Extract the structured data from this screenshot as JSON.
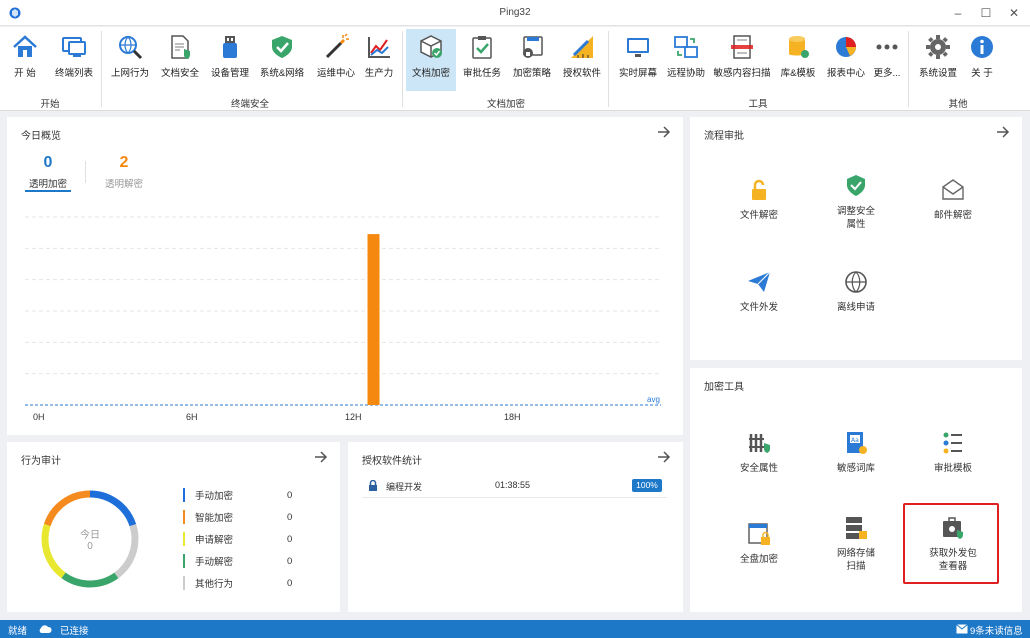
{
  "window": {
    "title": "Ping32"
  },
  "ribbon": {
    "items": [
      {
        "label": "开  始",
        "icon": "home-icon"
      },
      {
        "label": "终端列表",
        "icon": "monitor-list-icon"
      },
      {
        "label": "上网行为",
        "icon": "web-search-icon"
      },
      {
        "label": "文档安全",
        "icon": "document-shield-icon"
      },
      {
        "label": "设备管理",
        "icon": "usb-device-icon"
      },
      {
        "label": "系统&网络",
        "icon": "shield-firewall-icon"
      },
      {
        "label": "运维中心",
        "icon": "magic-wand-icon"
      },
      {
        "label": "生产力",
        "icon": "productivity-chart-icon"
      },
      {
        "label": "文档加密",
        "icon": "cube-encrypt-icon"
      },
      {
        "label": "审批任务",
        "icon": "clipboard-check-icon"
      },
      {
        "label": "加密策略",
        "icon": "lock-policy-icon"
      },
      {
        "label": "授权软件",
        "icon": "ruler-pencil-icon"
      },
      {
        "label": "实时屏幕",
        "icon": "screen-icon"
      },
      {
        "label": "远程协助",
        "icon": "remote-assist-icon"
      },
      {
        "label": "敏感内容扫描",
        "icon": "scan-document-icon"
      },
      {
        "label": "库&模板",
        "icon": "database-icon"
      },
      {
        "label": "报表中心",
        "icon": "pie-chart-icon"
      },
      {
        "label": "更多...",
        "icon": "more-dots-icon"
      },
      {
        "label": "系统设置",
        "icon": "gear-icon"
      },
      {
        "label": "关  于",
        "icon": "info-icon"
      }
    ],
    "groups": [
      "开始",
      "终端安全",
      "文档加密",
      "工具",
      "其他"
    ]
  },
  "overview": {
    "title": "今日概览",
    "stats": [
      {
        "value": "0",
        "label": "透明加密"
      },
      {
        "value": "2",
        "label": "透明解密"
      }
    ]
  },
  "chart_data": {
    "type": "bar",
    "x": [
      "0H",
      "6H",
      "12H",
      "18H"
    ],
    "avg_label": "avg",
    "bars": [
      {
        "hour": 13,
        "value": 2
      }
    ],
    "ylim": [
      0,
      2.2
    ],
    "grid": true,
    "color": "#f5890f"
  },
  "behavior": {
    "title": "行为审计",
    "donut_label": "今日",
    "donut_value": "0",
    "legend": [
      {
        "label": "手动加密",
        "value": "0",
        "color": "#1e6fd9"
      },
      {
        "label": "智能加密",
        "value": "0",
        "color": "#f58a1f"
      },
      {
        "label": "申请解密",
        "value": "0",
        "color": "#e8e830"
      },
      {
        "label": "手动解密",
        "value": "0",
        "color": "#3aa56a"
      },
      {
        "label": "其他行为",
        "value": "0",
        "color": "#cccccc"
      }
    ]
  },
  "software_stats": {
    "title": "授权软件统计",
    "rows": [
      {
        "name": "编程开发",
        "time": "01:38:55",
        "percent": "100%"
      }
    ]
  },
  "workflow": {
    "title": "流程审批",
    "tiles": [
      {
        "label": "文件解密",
        "icon": "unlock-icon"
      },
      {
        "label": "调整安全\n属性",
        "icon": "shield-check-icon"
      },
      {
        "label": "邮件解密",
        "icon": "mail-icon"
      },
      {
        "label": "文件外发",
        "icon": "paper-plane-icon"
      },
      {
        "label": "离线申请",
        "icon": "globe-icon"
      }
    ]
  },
  "tools": {
    "title": "加密工具",
    "tiles": [
      {
        "label": "安全属性",
        "icon": "fence-shield-icon"
      },
      {
        "label": "敏感词库",
        "icon": "word-library-icon"
      },
      {
        "label": "审批模板",
        "icon": "template-tree-icon"
      },
      {
        "label": "全盘加密",
        "icon": "disk-lock-icon"
      },
      {
        "label": "网络存储\n扫描",
        "icon": "server-lock-icon"
      },
      {
        "label": "获取外发包\n查看器",
        "icon": "package-viewer-icon"
      }
    ]
  },
  "statusbar": {
    "ready": "就绪",
    "connection": "已连接",
    "messages": "9条未读信息"
  },
  "colors": {
    "accent": "#1e78c8",
    "orange": "#f5890f",
    "highlight": "#e02020"
  }
}
